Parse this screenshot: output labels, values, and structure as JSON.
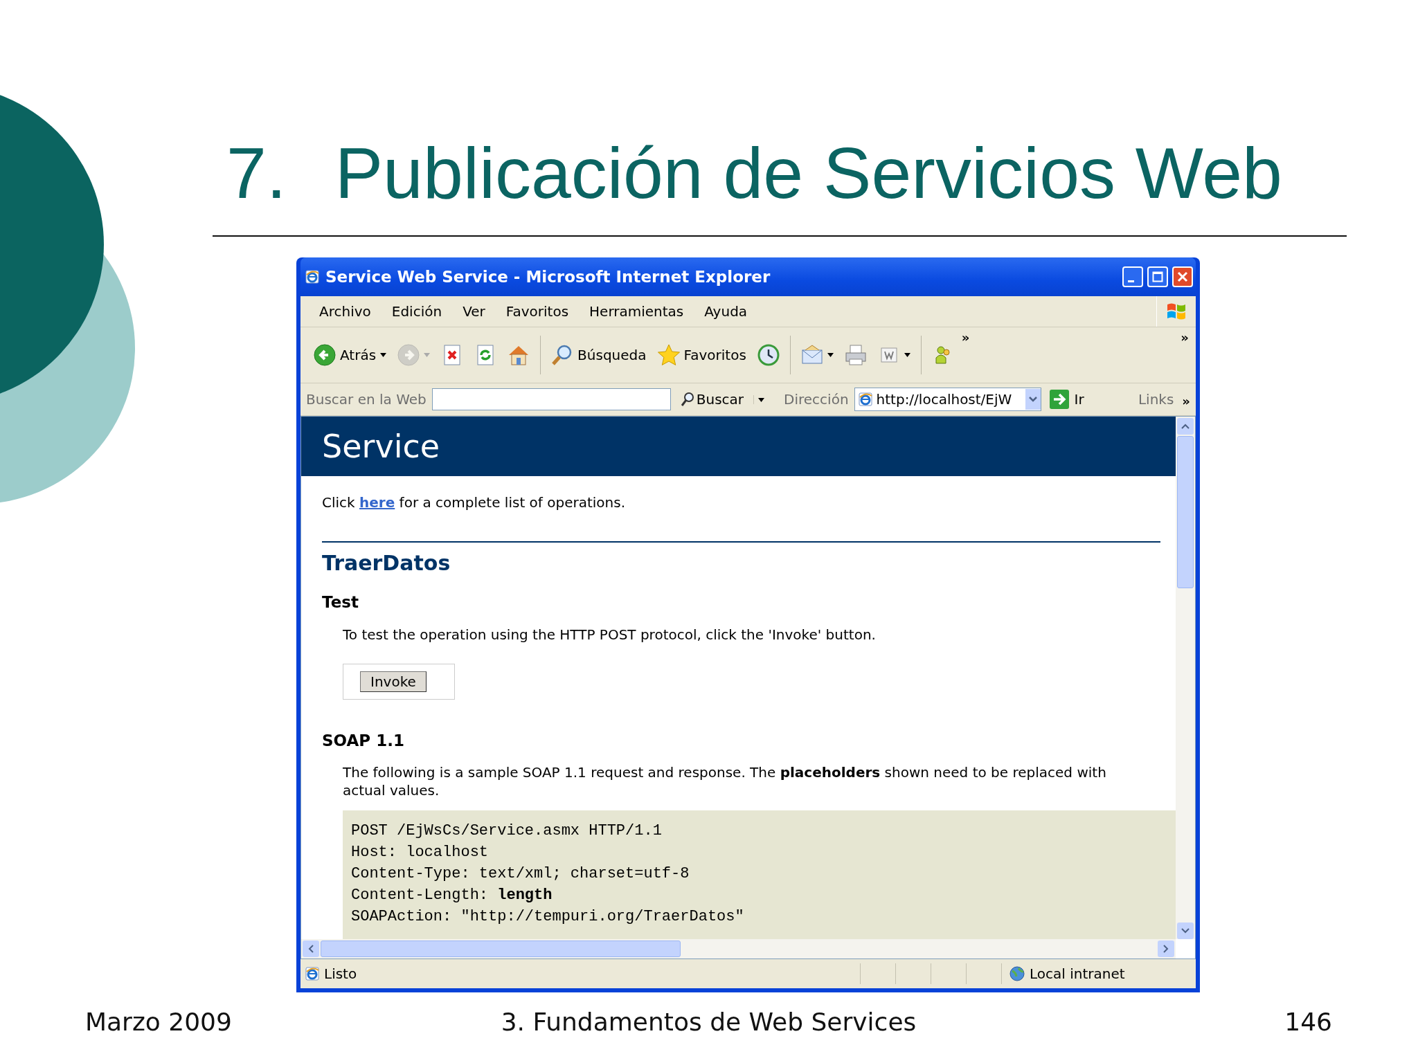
{
  "slide": {
    "number": "7.",
    "title": "Publicación de Servicios Web"
  },
  "window": {
    "title": "Service Web Service - Microsoft Internet Explorer"
  },
  "menu": [
    "Archivo",
    "Edición",
    "Ver",
    "Favoritos",
    "Herramientas",
    "Ayuda"
  ],
  "toolbar": [
    {
      "kind": "back",
      "label": "Atrás",
      "dropdown": true,
      "disabled": false
    },
    {
      "kind": "forward",
      "dropdown": true,
      "disabled": true
    },
    {
      "kind": "stop",
      "dropdown": false,
      "disabled": false
    },
    {
      "kind": "refresh",
      "dropdown": false,
      "disabled": false
    },
    {
      "kind": "home",
      "dropdown": false,
      "disabled": false
    },
    {
      "kind": "search",
      "label": "Búsqueda",
      "dropdown": false,
      "disabled": false
    },
    {
      "kind": "favorites",
      "label": "Favoritos",
      "dropdown": false,
      "disabled": false
    },
    {
      "kind": "history",
      "dropdown": false,
      "disabled": false
    },
    {
      "kind": "mail",
      "dropdown": true,
      "disabled": false
    },
    {
      "kind": "print",
      "dropdown": false,
      "disabled": false
    },
    {
      "kind": "edit",
      "dropdown": true,
      "disabled": false
    },
    {
      "kind": "messenger",
      "dropdown": false,
      "disabled": false
    }
  ],
  "toolbar_more": [
    "»",
    "»"
  ],
  "search_bar": {
    "label": "Buscar en la Web",
    "button": "Buscar"
  },
  "address_bar": {
    "label": "Dirección",
    "value": "http://localhost/EjW",
    "go": "Ir",
    "links": "Links",
    "more": "»"
  },
  "page": {
    "heading": "Service",
    "intro": {
      "before": "Click",
      "link": "here",
      "after": "for a complete list of operations."
    },
    "operation": "TraerDatos",
    "test_heading": "Test",
    "test_text": "To test the operation using the HTTP POST protocol, click the 'Invoke' button.",
    "invoke": "Invoke",
    "soap_heading": "SOAP 1.1",
    "soap_text": "The following is a sample SOAP 1.1 request and response. The **placeholders** shown need to be replaced with actual values.",
    "code": [
      "POST /EjWsCs/Service.asmx HTTP/1.1",
      "Host: localhost",
      "Content-Type: text/xml; charset=utf-8",
      "Content-Length: **length**",
      "SOAPAction: \"http://tempuri.org/TraerDatos\""
    ]
  },
  "status_bar": {
    "text": "Listo",
    "zone": "Local intranet"
  },
  "footer": {
    "date": "Marzo 2009",
    "subject": "3. Fundamentos de Web Services",
    "page": "146"
  }
}
